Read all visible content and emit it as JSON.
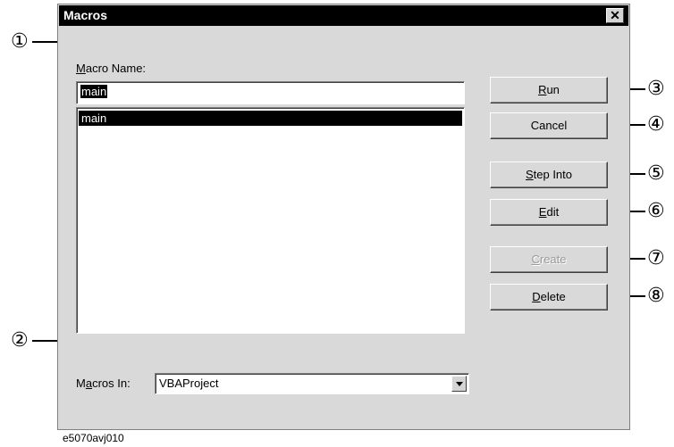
{
  "dialog": {
    "title": "Macros",
    "close_label": "✕",
    "macro_name_label_access": "M",
    "macro_name_label_rest": "acro Name:",
    "macro_name_value": "main",
    "macro_list": [
      "main"
    ],
    "macros_in_label_pre": "M",
    "macros_in_label_access": "a",
    "macros_in_label_rest": "cros In:",
    "macros_in_value": "VBAProject"
  },
  "buttons": [
    {
      "access": "R",
      "rest": "un",
      "enabled": true
    },
    {
      "access": "",
      "rest": "Cancel",
      "enabled": true
    },
    {
      "access": "S",
      "rest": "tep Into",
      "enabled": true
    },
    {
      "access": "E",
      "rest": "dit",
      "enabled": true
    },
    {
      "access": "C",
      "rest": "reate",
      "enabled": false
    },
    {
      "access": "D",
      "rest": "elete",
      "enabled": true
    }
  ],
  "callouts": [
    "①",
    "②",
    "③",
    "④",
    "⑤",
    "⑥",
    "⑦",
    "⑧"
  ],
  "figure_id": "e5070avj010"
}
